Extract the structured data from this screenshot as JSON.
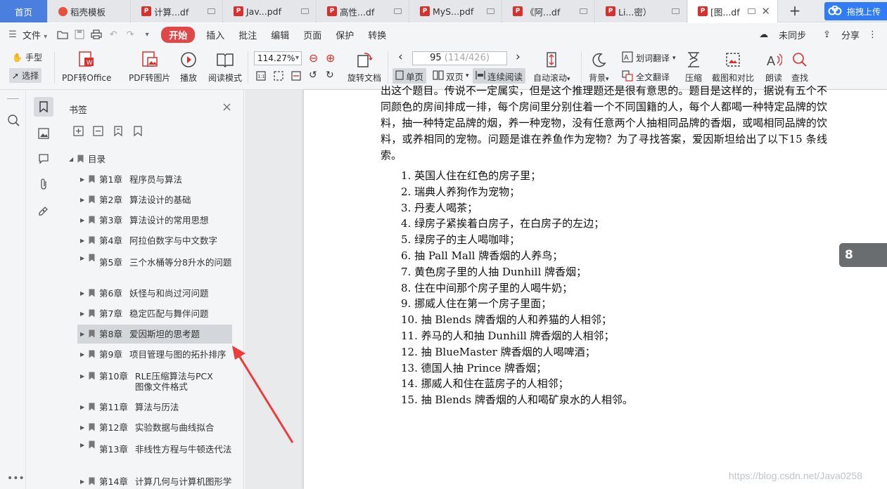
{
  "tabs": [
    {
      "label": "首页",
      "kind": "home"
    },
    {
      "label": "稻壳模板",
      "kind": "docer"
    },
    {
      "label": "计算...df",
      "kind": "pdf"
    },
    {
      "label": "Jav...pdf",
      "kind": "pdf"
    },
    {
      "label": "高性...df",
      "kind": "pdf"
    },
    {
      "label": "MyS...pdf",
      "kind": "pdf"
    },
    {
      "label": "《阿...df",
      "kind": "pdf"
    },
    {
      "label": "Li...密）",
      "kind": "pdf"
    },
    {
      "label": "[图...df",
      "kind": "pdf",
      "active": true
    }
  ],
  "upload_label": "拖拽上传",
  "menu": {
    "file": "文件",
    "start": "开始",
    "items": [
      "插入",
      "批注",
      "编辑",
      "页面",
      "保护",
      "转换"
    ],
    "sync": "未同步",
    "share": "分享"
  },
  "toolbar": {
    "hand": "手型",
    "select": "选择",
    "pdf_to_office": "PDF转Office",
    "pdf_to_image": "PDF转图片",
    "play": "播放",
    "read_mode": "阅读模式",
    "zoom": "114.27%",
    "rotate": "旋转文档",
    "page_current": "95",
    "page_total": "(114/426)",
    "single": "单页",
    "double": "双页",
    "continuous": "连续阅读",
    "auto_scroll": "自动滚动",
    "background": "背景",
    "word_translate": "划词翻译",
    "full_translate": "全文翻译",
    "compress": "压缩",
    "screenshot_compare": "截图和对比",
    "read_aloud": "朗读",
    "find": "查找"
  },
  "bookmarks": {
    "title": "书签",
    "root": "目录",
    "items": [
      {
        "ch": "第1章",
        "title": "程序员与算法"
      },
      {
        "ch": "第2章",
        "title": "算法设计的基础"
      },
      {
        "ch": "第3章",
        "title": "算法设计的常用思想"
      },
      {
        "ch": "第4章",
        "title": "阿拉伯数字与中文数字"
      },
      {
        "ch": "第5章",
        "title": "三个水桶等分8升水的问题"
      },
      {
        "ch": "第6章",
        "title": "妖怪与和尚过河问题"
      },
      {
        "ch": "第7章",
        "title": "稳定匹配与舞伴问题"
      },
      {
        "ch": "第8章",
        "title": "爱因斯坦的思考题",
        "selected": true
      },
      {
        "ch": "第9章",
        "title": "项目管理与图的拓扑排序"
      },
      {
        "ch": "第10章",
        "title": "RLE压缩算法与PCX图像文件格式"
      },
      {
        "ch": "第11章",
        "title": "算法与历法"
      },
      {
        "ch": "第12章",
        "title": "实验数据与曲线拟合"
      },
      {
        "ch": "第13章",
        "title": "非线性方程与牛顿迭代法"
      },
      {
        "ch": "第14章",
        "title": "计算几何与计算机图形学"
      }
    ]
  },
  "document": {
    "paragraph": "出这个题目。传说不一定属实，但是这个推理题还是很有意思的。题目是这样的，据说有五个不同颜色的房间排成一排，每个房间里分别住着一个不同国籍的人，每个人都喝一种特定品牌的饮料，抽一种特定品牌的烟，养一种宠物，没有任意两个人抽相同品牌的香烟，或喝相同品牌的饮料，或养相同的宠物。问题是谁在养鱼作为宠物？为了寻找答案，爱因斯坦给出了以下15 条线索。",
    "clues": [
      "1. 英国人住在红色的房子里；",
      "2. 瑞典人养狗作为宠物；",
      "3. 丹麦人喝茶；",
      "4. 绿房子紧挨着白房子，在白房子的左边；",
      "5. 绿房子的主人喝咖啡；",
      "6. 抽 Pall Mall 牌香烟的人养鸟；",
      "7. 黄色房子里的人抽 Dunhill 牌香烟；",
      "8. 住在中间那个房子里的人喝牛奶；",
      "9. 挪威人住在第一个房子里面；",
      "10. 抽 Blends 牌香烟的人和养猫的人相邻；",
      "11. 养马的人和抽 Dunhill 牌香烟的人相邻；",
      "12. 抽 BlueMaster 牌香烟的人喝啤酒；",
      "13. 德国人抽 Prince 牌香烟；",
      "14. 挪威人和住在蓝房子的人相邻；",
      "15. 抽 Blends 牌香烟的人和喝矿泉水的人相邻。"
    ],
    "page_badge": "8"
  },
  "watermark": "https://blog.csdn.net/Java0258",
  "colors": {
    "accent": "#e04848",
    "tab_home": "#4a7fe0",
    "upload": "#2f7cf6",
    "annotation_arrow": "#ee3b3b"
  }
}
